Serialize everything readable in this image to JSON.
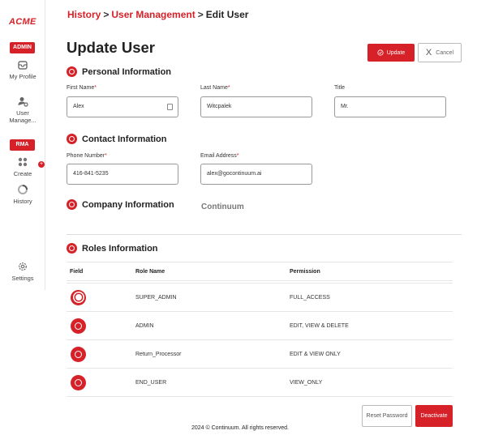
{
  "sidebar": {
    "logo": "ACME",
    "badge_admin": "ADMIN",
    "badge_rma": "RMA",
    "items": [
      {
        "label": "My Profile",
        "icon": "inbox-icon"
      },
      {
        "label": "User Manage...",
        "icon": "user-gear-icon"
      },
      {
        "label": "Create",
        "icon": "grid-icon"
      },
      {
        "label": "History",
        "icon": "history-icon"
      },
      {
        "label": "Settings",
        "icon": "gear-icon"
      }
    ]
  },
  "breadcrumb": {
    "items": [
      "History",
      "User Management",
      "Edit User"
    ],
    "separator": ">"
  },
  "page_title": "Update User",
  "actions": {
    "update_label": "Update",
    "cancel_label": "Cancel",
    "cancel_icon": "X"
  },
  "personal": {
    "title": "Personal Information",
    "first_name_label": "First Name",
    "first_name": "Alex",
    "last_name_label": "Last Name",
    "last_name": "Witcpalek",
    "title_label": "Title",
    "title_value": "Mr."
  },
  "contact": {
    "title": "Contact Information",
    "phone_label": "Phone Number",
    "phone": "416-841-5235",
    "email_label": "Email Address",
    "email": "alex@gocontinuum.ai"
  },
  "company": {
    "title": "Company Information",
    "value": "Continuum"
  },
  "roles": {
    "title": "Roles Information",
    "headers": [
      "Field",
      "Role Name",
      "Permission"
    ],
    "rows": [
      {
        "role": "SUPER_ADMIN",
        "permission": "FULL_ACCESS",
        "selected": true
      },
      {
        "role": "ADMIN",
        "permission": "EDIT, VIEW & DELETE",
        "selected": false
      },
      {
        "role": "Return_Processor",
        "permission": "EDIT & VIEW ONLY",
        "selected": false
      },
      {
        "role": "END_USER",
        "permission": "VIEW_ONLY",
        "selected": false
      }
    ]
  },
  "bottom_actions": {
    "reset_label": "Reset Password",
    "deactivate_label": "Deactivate"
  },
  "footer": "2024 © Continuum. All rights reserved.",
  "colors": {
    "accent": "#d62128"
  }
}
